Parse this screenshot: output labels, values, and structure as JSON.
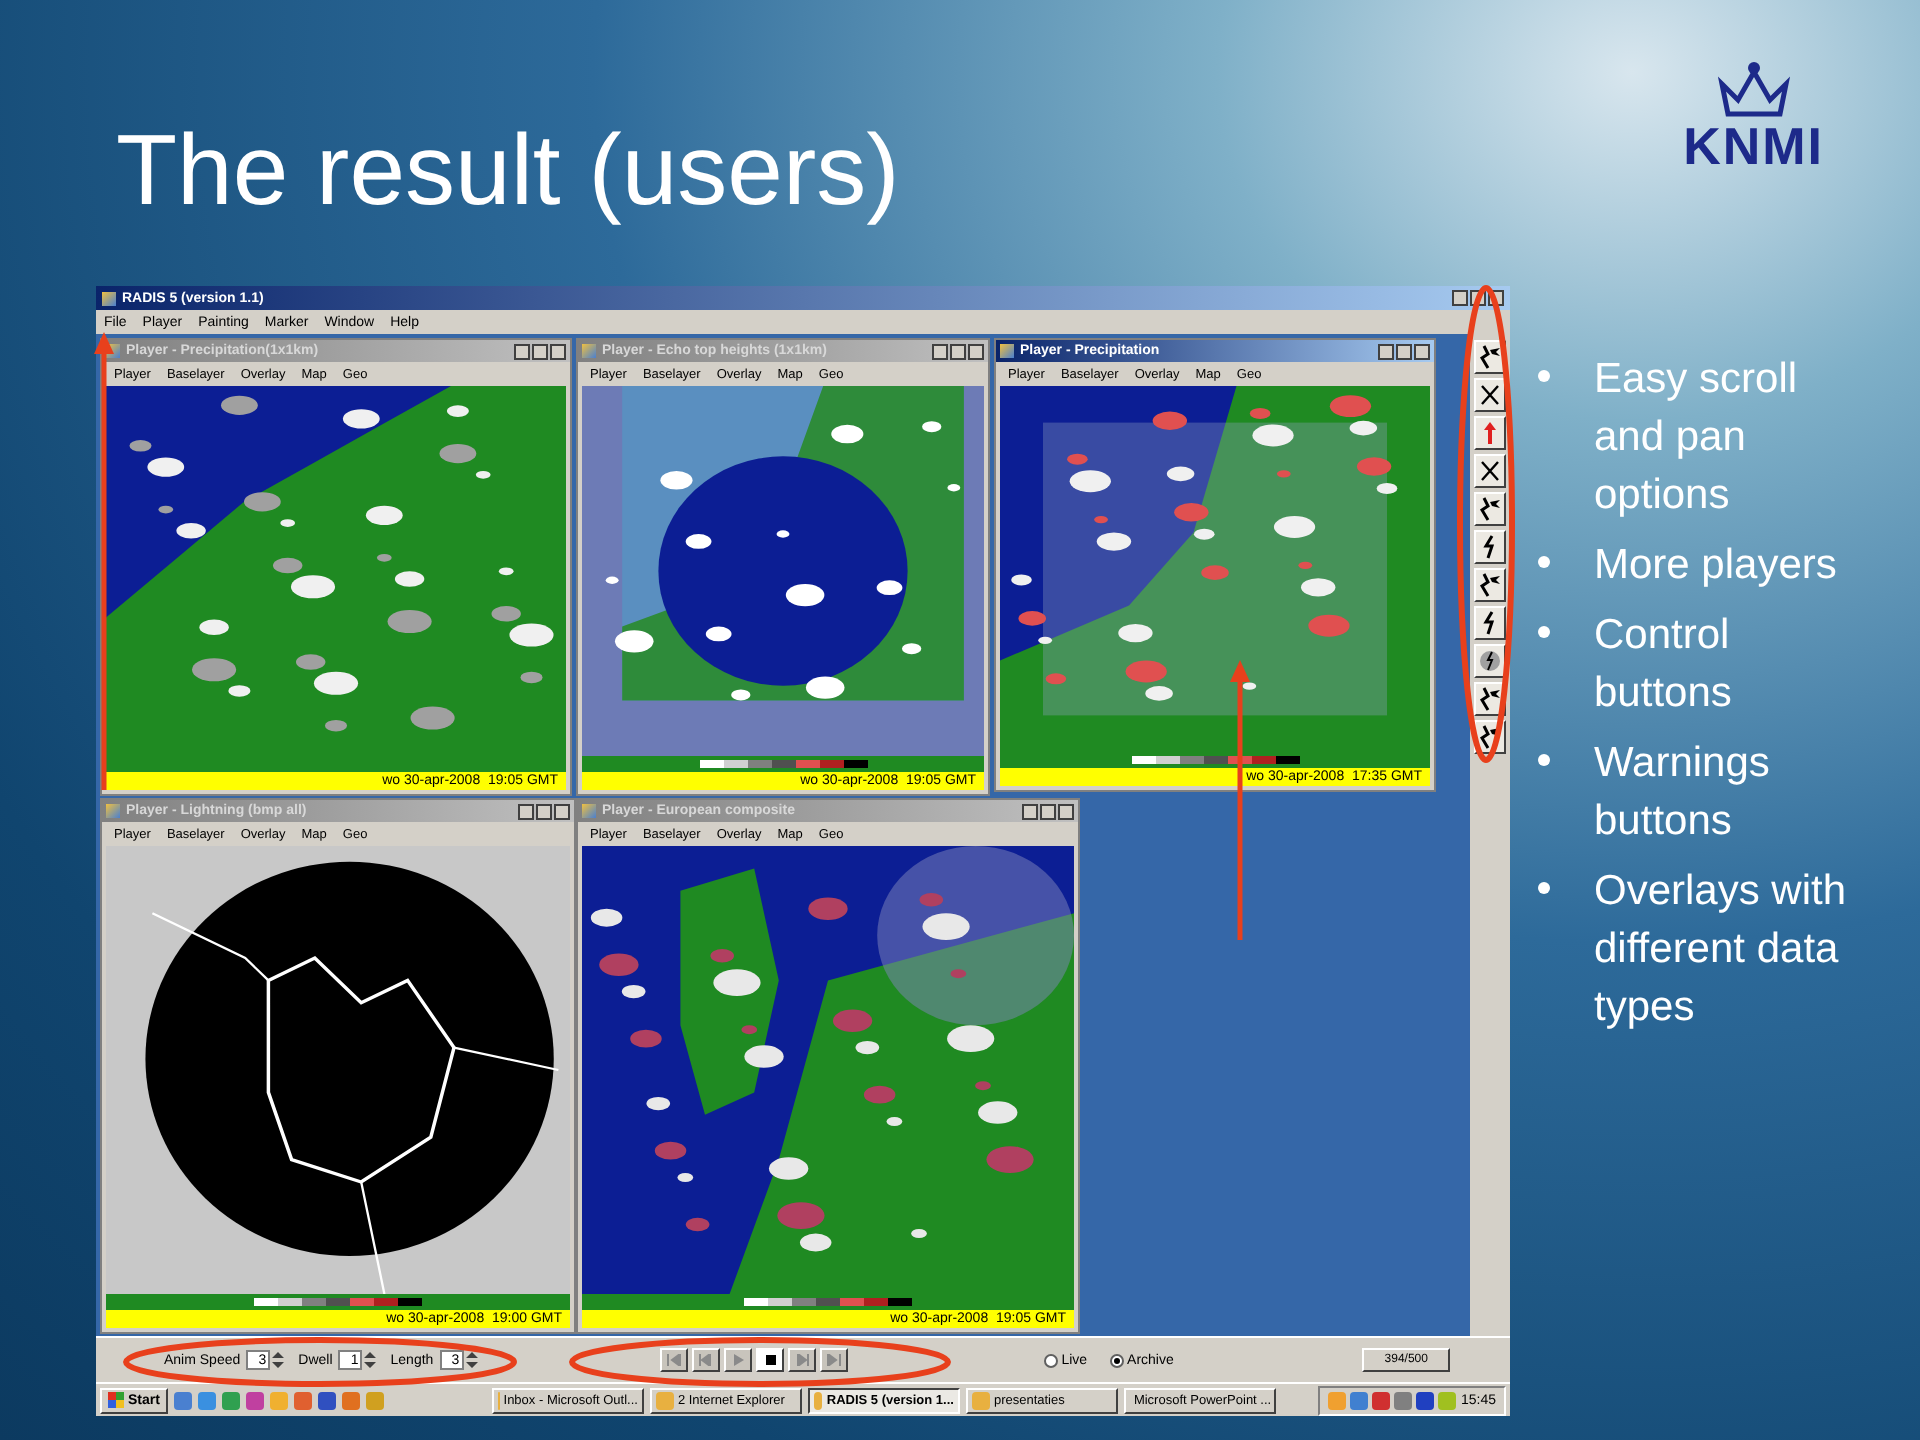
{
  "slide": {
    "title": "The result (users)",
    "logo": "KNMI",
    "bullets": [
      "Easy scroll and pan options",
      "More players",
      "Control buttons",
      "Warnings buttons",
      "Overlays with different data types"
    ]
  },
  "app": {
    "title": "RADIS 5 (version 1.1)",
    "menu": [
      "File",
      "Player",
      "Painting",
      "Marker",
      "Window",
      "Help"
    ],
    "players": [
      {
        "title": "Player - Precipitation(1x1km)",
        "active": false,
        "menu": [
          "Player",
          "Baselayer",
          "Overlay",
          "Map",
          "Geo"
        ],
        "kind": "precipitation",
        "legend": false,
        "timestamp": "wo 30-apr-2008  19:05 GMT"
      },
      {
        "title": "Player - Echo top heights (1x1km)",
        "active": false,
        "menu": [
          "Player",
          "Baselayer",
          "Overlay",
          "Map",
          "Geo"
        ],
        "kind": "echo",
        "legend": true,
        "timestamp": "wo 30-apr-2008  19:05 GMT"
      },
      {
        "title": "Player - Precipitation",
        "active": true,
        "menu": [
          "Player",
          "Baselayer",
          "Overlay",
          "Map",
          "Geo"
        ],
        "kind": "radar",
        "legend": true,
        "timestamp": "wo 30-apr-2008  17:35 GMT"
      },
      {
        "title": "Player - Lightning (bmp all)",
        "active": false,
        "menu": [
          "Player",
          "Baselayer",
          "Overlay",
          "Map",
          "Geo"
        ],
        "kind": "lightning",
        "legend": true,
        "timestamp": "wo 30-apr-2008  19:00 GMT"
      },
      {
        "title": "Player - European composite",
        "active": false,
        "menu": [
          "Player",
          "Baselayer",
          "Overlay",
          "Map",
          "Geo"
        ],
        "kind": "composite",
        "legend": true,
        "timestamp": "wo 30-apr-2008  19:05 GMT"
      }
    ],
    "toolbar": [
      {
        "kind": "plane"
      },
      {
        "kind": "cross"
      },
      {
        "kind": "arrow"
      },
      {
        "kind": "cross"
      },
      {
        "kind": "plane"
      },
      {
        "kind": "bolt"
      },
      {
        "kind": "plane"
      },
      {
        "kind": "bolt"
      },
      {
        "kind": "circle"
      },
      {
        "kind": "plane"
      },
      {
        "kind": "plane"
      }
    ],
    "controls": {
      "fields": [
        {
          "label": "Anim Speed",
          "value": "3"
        },
        {
          "label": "Dwell",
          "value": "1"
        },
        {
          "label": "Length",
          "value": "3"
        }
      ],
      "media_buttons": [
        {
          "kind": "first",
          "selected": false
        },
        {
          "kind": "back",
          "selected": false
        },
        {
          "kind": "play",
          "selected": false
        },
        {
          "kind": "stop",
          "selected": true
        },
        {
          "kind": "forward",
          "selected": false
        },
        {
          "kind": "last",
          "selected": false
        }
      ],
      "modes": [
        {
          "label": "Live",
          "selected": false
        },
        {
          "label": "Archive",
          "selected": true
        }
      ],
      "counter": "394/500"
    }
  },
  "taskbar": {
    "start": "Start",
    "tasks": [
      {
        "label": "Inbox - Microsoft Outl...",
        "selected": false
      },
      {
        "label": "2 Internet Explorer",
        "selected": false
      },
      {
        "label": "RADIS 5 (version 1...",
        "selected": true
      },
      {
        "label": "presentaties",
        "selected": false
      },
      {
        "label": "Microsoft PowerPoint ...",
        "selected": false
      }
    ],
    "clock": "15:45"
  }
}
